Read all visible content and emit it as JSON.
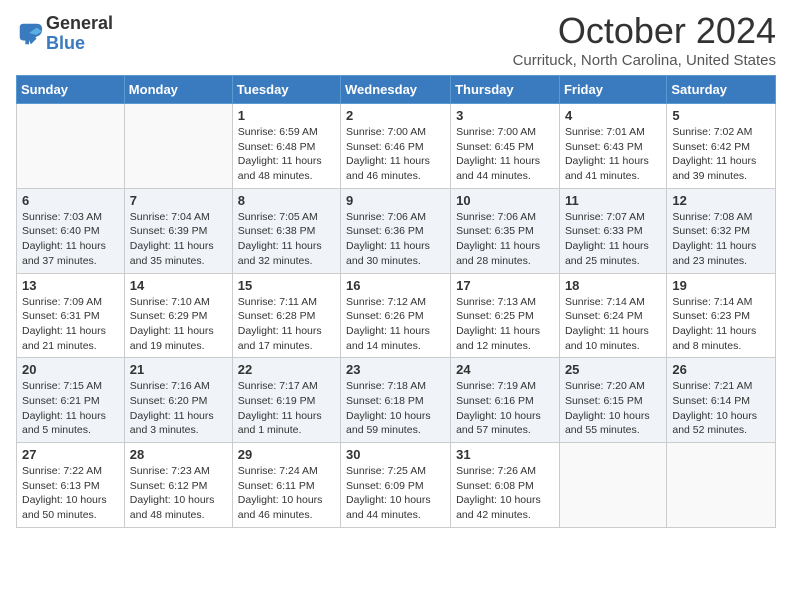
{
  "logo": {
    "general": "General",
    "blue": "Blue"
  },
  "header": {
    "title": "October 2024",
    "subtitle": "Currituck, North Carolina, United States"
  },
  "weekdays": [
    "Sunday",
    "Monday",
    "Tuesday",
    "Wednesday",
    "Thursday",
    "Friday",
    "Saturday"
  ],
  "weeks": [
    [
      {
        "day": "",
        "sunrise": "",
        "sunset": "",
        "daylight": ""
      },
      {
        "day": "",
        "sunrise": "",
        "sunset": "",
        "daylight": ""
      },
      {
        "day": "1",
        "sunrise": "Sunrise: 6:59 AM",
        "sunset": "Sunset: 6:48 PM",
        "daylight": "Daylight: 11 hours and 48 minutes."
      },
      {
        "day": "2",
        "sunrise": "Sunrise: 7:00 AM",
        "sunset": "Sunset: 6:46 PM",
        "daylight": "Daylight: 11 hours and 46 minutes."
      },
      {
        "day": "3",
        "sunrise": "Sunrise: 7:00 AM",
        "sunset": "Sunset: 6:45 PM",
        "daylight": "Daylight: 11 hours and 44 minutes."
      },
      {
        "day": "4",
        "sunrise": "Sunrise: 7:01 AM",
        "sunset": "Sunset: 6:43 PM",
        "daylight": "Daylight: 11 hours and 41 minutes."
      },
      {
        "day": "5",
        "sunrise": "Sunrise: 7:02 AM",
        "sunset": "Sunset: 6:42 PM",
        "daylight": "Daylight: 11 hours and 39 minutes."
      }
    ],
    [
      {
        "day": "6",
        "sunrise": "Sunrise: 7:03 AM",
        "sunset": "Sunset: 6:40 PM",
        "daylight": "Daylight: 11 hours and 37 minutes."
      },
      {
        "day": "7",
        "sunrise": "Sunrise: 7:04 AM",
        "sunset": "Sunset: 6:39 PM",
        "daylight": "Daylight: 11 hours and 35 minutes."
      },
      {
        "day": "8",
        "sunrise": "Sunrise: 7:05 AM",
        "sunset": "Sunset: 6:38 PM",
        "daylight": "Daylight: 11 hours and 32 minutes."
      },
      {
        "day": "9",
        "sunrise": "Sunrise: 7:06 AM",
        "sunset": "Sunset: 6:36 PM",
        "daylight": "Daylight: 11 hours and 30 minutes."
      },
      {
        "day": "10",
        "sunrise": "Sunrise: 7:06 AM",
        "sunset": "Sunset: 6:35 PM",
        "daylight": "Daylight: 11 hours and 28 minutes."
      },
      {
        "day": "11",
        "sunrise": "Sunrise: 7:07 AM",
        "sunset": "Sunset: 6:33 PM",
        "daylight": "Daylight: 11 hours and 25 minutes."
      },
      {
        "day": "12",
        "sunrise": "Sunrise: 7:08 AM",
        "sunset": "Sunset: 6:32 PM",
        "daylight": "Daylight: 11 hours and 23 minutes."
      }
    ],
    [
      {
        "day": "13",
        "sunrise": "Sunrise: 7:09 AM",
        "sunset": "Sunset: 6:31 PM",
        "daylight": "Daylight: 11 hours and 21 minutes."
      },
      {
        "day": "14",
        "sunrise": "Sunrise: 7:10 AM",
        "sunset": "Sunset: 6:29 PM",
        "daylight": "Daylight: 11 hours and 19 minutes."
      },
      {
        "day": "15",
        "sunrise": "Sunrise: 7:11 AM",
        "sunset": "Sunset: 6:28 PM",
        "daylight": "Daylight: 11 hours and 17 minutes."
      },
      {
        "day": "16",
        "sunrise": "Sunrise: 7:12 AM",
        "sunset": "Sunset: 6:26 PM",
        "daylight": "Daylight: 11 hours and 14 minutes."
      },
      {
        "day": "17",
        "sunrise": "Sunrise: 7:13 AM",
        "sunset": "Sunset: 6:25 PM",
        "daylight": "Daylight: 11 hours and 12 minutes."
      },
      {
        "day": "18",
        "sunrise": "Sunrise: 7:14 AM",
        "sunset": "Sunset: 6:24 PM",
        "daylight": "Daylight: 11 hours and 10 minutes."
      },
      {
        "day": "19",
        "sunrise": "Sunrise: 7:14 AM",
        "sunset": "Sunset: 6:23 PM",
        "daylight": "Daylight: 11 hours and 8 minutes."
      }
    ],
    [
      {
        "day": "20",
        "sunrise": "Sunrise: 7:15 AM",
        "sunset": "Sunset: 6:21 PM",
        "daylight": "Daylight: 11 hours and 5 minutes."
      },
      {
        "day": "21",
        "sunrise": "Sunrise: 7:16 AM",
        "sunset": "Sunset: 6:20 PM",
        "daylight": "Daylight: 11 hours and 3 minutes."
      },
      {
        "day": "22",
        "sunrise": "Sunrise: 7:17 AM",
        "sunset": "Sunset: 6:19 PM",
        "daylight": "Daylight: 11 hours and 1 minute."
      },
      {
        "day": "23",
        "sunrise": "Sunrise: 7:18 AM",
        "sunset": "Sunset: 6:18 PM",
        "daylight": "Daylight: 10 hours and 59 minutes."
      },
      {
        "day": "24",
        "sunrise": "Sunrise: 7:19 AM",
        "sunset": "Sunset: 6:16 PM",
        "daylight": "Daylight: 10 hours and 57 minutes."
      },
      {
        "day": "25",
        "sunrise": "Sunrise: 7:20 AM",
        "sunset": "Sunset: 6:15 PM",
        "daylight": "Daylight: 10 hours and 55 minutes."
      },
      {
        "day": "26",
        "sunrise": "Sunrise: 7:21 AM",
        "sunset": "Sunset: 6:14 PM",
        "daylight": "Daylight: 10 hours and 52 minutes."
      }
    ],
    [
      {
        "day": "27",
        "sunrise": "Sunrise: 7:22 AM",
        "sunset": "Sunset: 6:13 PM",
        "daylight": "Daylight: 10 hours and 50 minutes."
      },
      {
        "day": "28",
        "sunrise": "Sunrise: 7:23 AM",
        "sunset": "Sunset: 6:12 PM",
        "daylight": "Daylight: 10 hours and 48 minutes."
      },
      {
        "day": "29",
        "sunrise": "Sunrise: 7:24 AM",
        "sunset": "Sunset: 6:11 PM",
        "daylight": "Daylight: 10 hours and 46 minutes."
      },
      {
        "day": "30",
        "sunrise": "Sunrise: 7:25 AM",
        "sunset": "Sunset: 6:09 PM",
        "daylight": "Daylight: 10 hours and 44 minutes."
      },
      {
        "day": "31",
        "sunrise": "Sunrise: 7:26 AM",
        "sunset": "Sunset: 6:08 PM",
        "daylight": "Daylight: 10 hours and 42 minutes."
      },
      {
        "day": "",
        "sunrise": "",
        "sunset": "",
        "daylight": ""
      },
      {
        "day": "",
        "sunrise": "",
        "sunset": "",
        "daylight": ""
      }
    ]
  ]
}
